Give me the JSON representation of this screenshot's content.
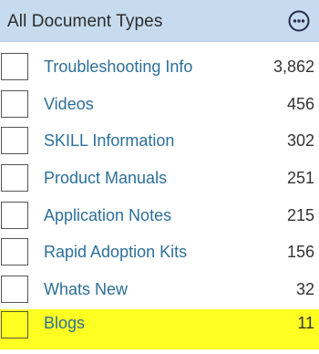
{
  "header": {
    "title": "All Document Types",
    "more_icon": "more-horizontal-circle-icon"
  },
  "items": [
    {
      "label": "Troubleshooting Info",
      "count": "3,862",
      "checked": false,
      "highlighted": false
    },
    {
      "label": "Videos",
      "count": "456",
      "checked": false,
      "highlighted": false
    },
    {
      "label": "SKILL Information",
      "count": "302",
      "checked": false,
      "highlighted": false
    },
    {
      "label": "Product Manuals",
      "count": "251",
      "checked": false,
      "highlighted": false
    },
    {
      "label": "Application Notes",
      "count": "215",
      "checked": false,
      "highlighted": false
    },
    {
      "label": "Rapid Adoption Kits",
      "count": "156",
      "checked": false,
      "highlighted": false
    },
    {
      "label": "Whats New",
      "count": "32",
      "checked": false,
      "highlighted": false
    },
    {
      "label": "Blogs",
      "count": "11",
      "checked": false,
      "highlighted": true
    }
  ],
  "colors": {
    "header_bg": "#c6dbed",
    "link": "#2d6f99",
    "highlight": "#ffff22"
  }
}
